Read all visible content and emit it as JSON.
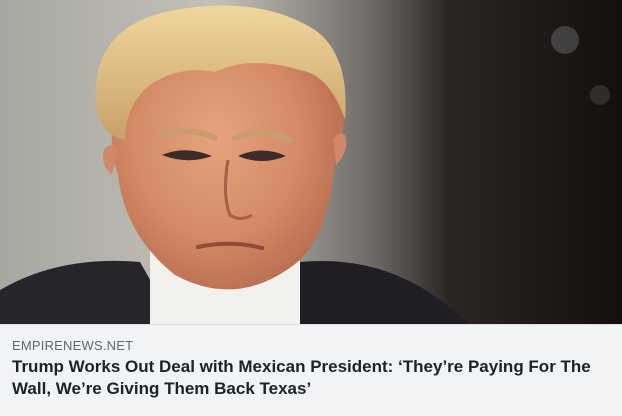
{
  "link_preview": {
    "image_alt": "",
    "domain": "EMPIRENEWS.NET",
    "headline": "Trump Works Out Deal with Mexican President: ‘They’re Paying For The Wall, We’re Giving Them Back Texas’"
  },
  "colors": {
    "meta_background": "#f2f3f5",
    "domain_text": "#606770",
    "headline_text": "#1d2129"
  }
}
